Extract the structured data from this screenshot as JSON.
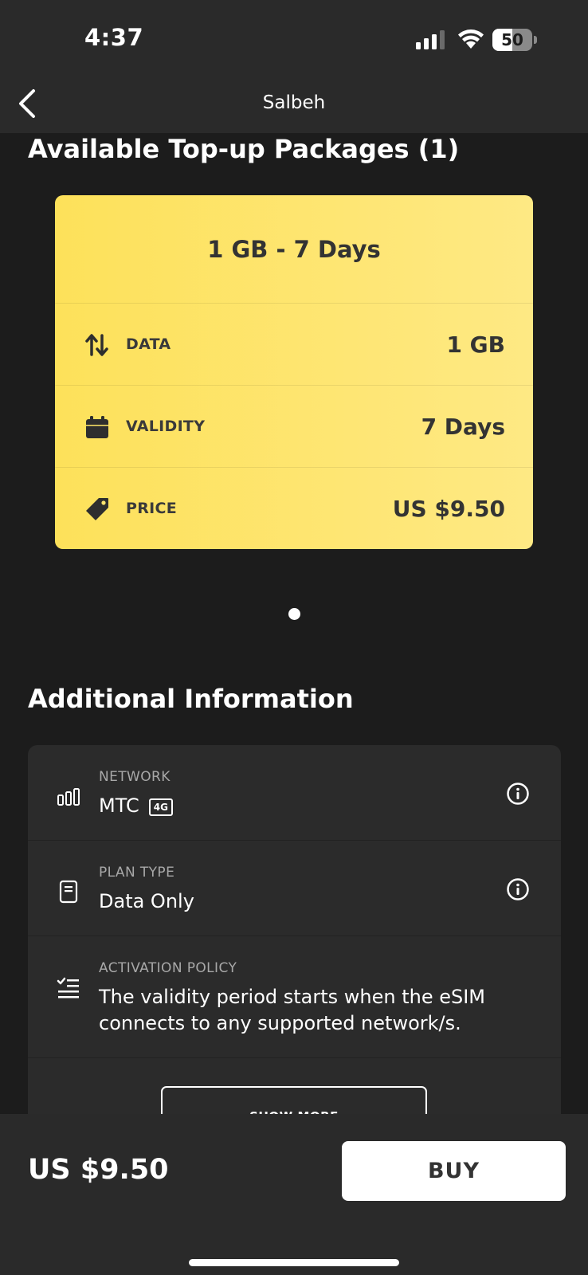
{
  "status_bar": {
    "time": "4:37",
    "battery": "50",
    "battery_level_percent": 50,
    "icons": [
      "signal-icon",
      "wifi-icon",
      "battery-icon"
    ]
  },
  "header": {
    "title": "Salbeh",
    "back_icon": "chevron-left-icon"
  },
  "packages": {
    "section_title": "Available Top-up Packages (1)",
    "card": {
      "title": "1 GB - 7 Days",
      "rows": [
        {
          "icon": "up-down-arrows-icon",
          "label": "DATA",
          "value": "1 GB"
        },
        {
          "icon": "calendar-icon",
          "label": "VALIDITY",
          "value": "7 Days"
        },
        {
          "icon": "price-tag-icon",
          "label": "PRICE",
          "value": "US $9.50"
        }
      ],
      "colors": {
        "gradient_start": "#fde15a",
        "gradient_end": "#fee984"
      }
    },
    "pager": {
      "current": 1,
      "total": 1
    }
  },
  "additional_info": {
    "section_title": "Additional Information",
    "rows": [
      {
        "icon": "network-bars-icon",
        "label": "NETWORK",
        "value": "MTC",
        "badge": "4G",
        "info_icon": "info-icon"
      },
      {
        "icon": "document-icon",
        "label": "PLAN TYPE",
        "value": "Data Only",
        "info_icon": "info-icon"
      },
      {
        "icon": "checklist-icon",
        "label": "ACTIVATION POLICY",
        "value_lines": [
          "The validity period starts when the eSIM",
          "connects to any supported network/s."
        ]
      }
    ],
    "show_more_label": "SHOW MORE"
  },
  "bottom_bar": {
    "price": "US $9.50",
    "buy_label": "BUY"
  }
}
